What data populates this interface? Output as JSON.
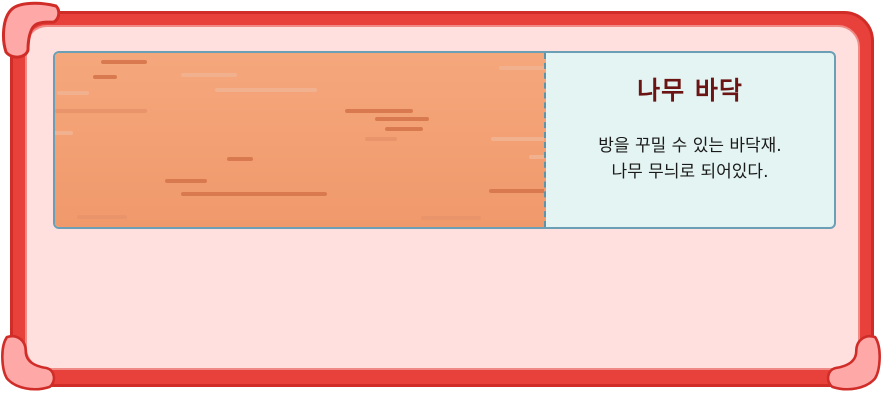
{
  "item": {
    "name": "나무 바닥",
    "description_line1": "방을 꾸밀 수 있는 바닥재.",
    "description_line2": "나무 무늬로 되어있다.",
    "preview_icon": "wood-floor-texture"
  },
  "colors": {
    "frame": "#e8403a",
    "frame_inner": "#ffe0de",
    "corner": "#ffa8a8",
    "card_border": "#6a9fb5",
    "info_bg": "#e4f4f2",
    "wood_top": "#f5a77c",
    "wood_bottom": "#f0996c",
    "title": "#6a1414"
  }
}
